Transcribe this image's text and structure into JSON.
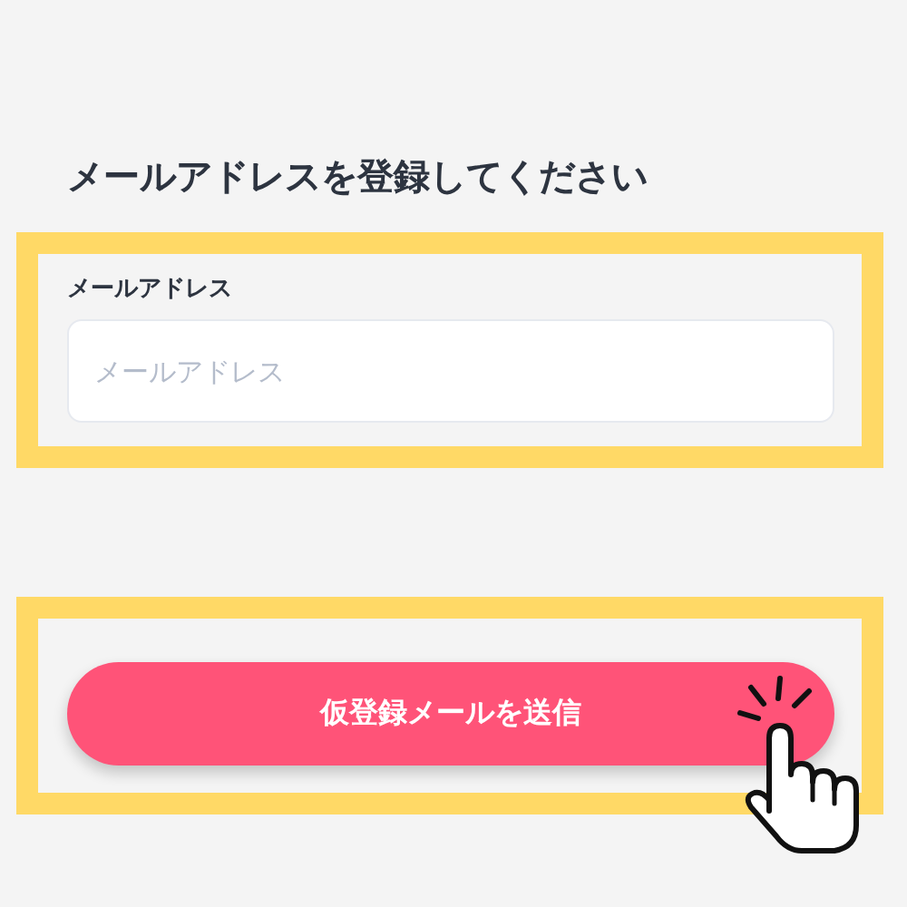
{
  "heading": "メールアドレスを登録してください",
  "email_field": {
    "label": "メールアドレス",
    "placeholder": "メールアドレス",
    "highlighted": true
  },
  "submit_button": {
    "label": "仮登録メールを送信",
    "highlighted": true
  }
}
